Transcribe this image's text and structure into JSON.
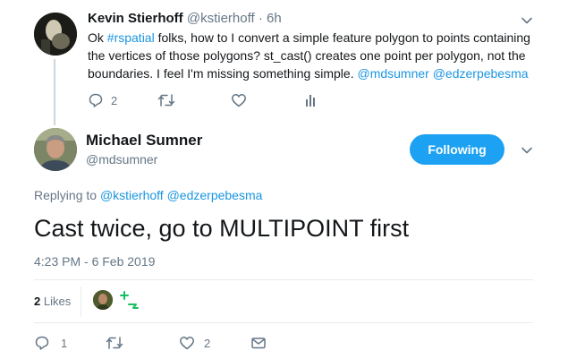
{
  "parent_tweet": {
    "author_name": "Kevin Stierhoff",
    "author_handle": "@kstierhoff",
    "time_ago": "· 6h",
    "text_pre": "Ok ",
    "hashtag": "#rspatial",
    "text_post": " folks, how to I convert a simple feature polygon to points containing the vertices of those polygons? st_cast() creates one point per polygon, not the boundaries. I feel I'm missing something simple. ",
    "mention1": "@mdsumner",
    "mention2": "@edzerpebesma",
    "reply_count": "2",
    "icons": {
      "reply": "reply-icon",
      "retweet": "retweet-icon",
      "like": "heart-icon",
      "analytics": "analytics-icon",
      "menu": "chevron-down-icon"
    }
  },
  "main_tweet": {
    "author_name": "Michael Sumner",
    "author_handle": "@mdsumner",
    "follow_label": "Following",
    "replying_prefix": "Replying to ",
    "replying_to_1": "@kstierhoff",
    "replying_to_2": "@edzerpebesma",
    "text": "Cast twice, go to MULTIPOINT first",
    "timestamp": "4:23 PM - 6 Feb 2019",
    "likes_count": "2",
    "likes_label": "Likes",
    "reply_count": "1",
    "like_count": "2",
    "accent_color": "#1da1f2",
    "icons": {
      "reply": "reply-icon",
      "retweet": "retweet-icon",
      "like": "heart-icon",
      "dm": "envelope-icon",
      "menu": "chevron-down-icon"
    }
  }
}
